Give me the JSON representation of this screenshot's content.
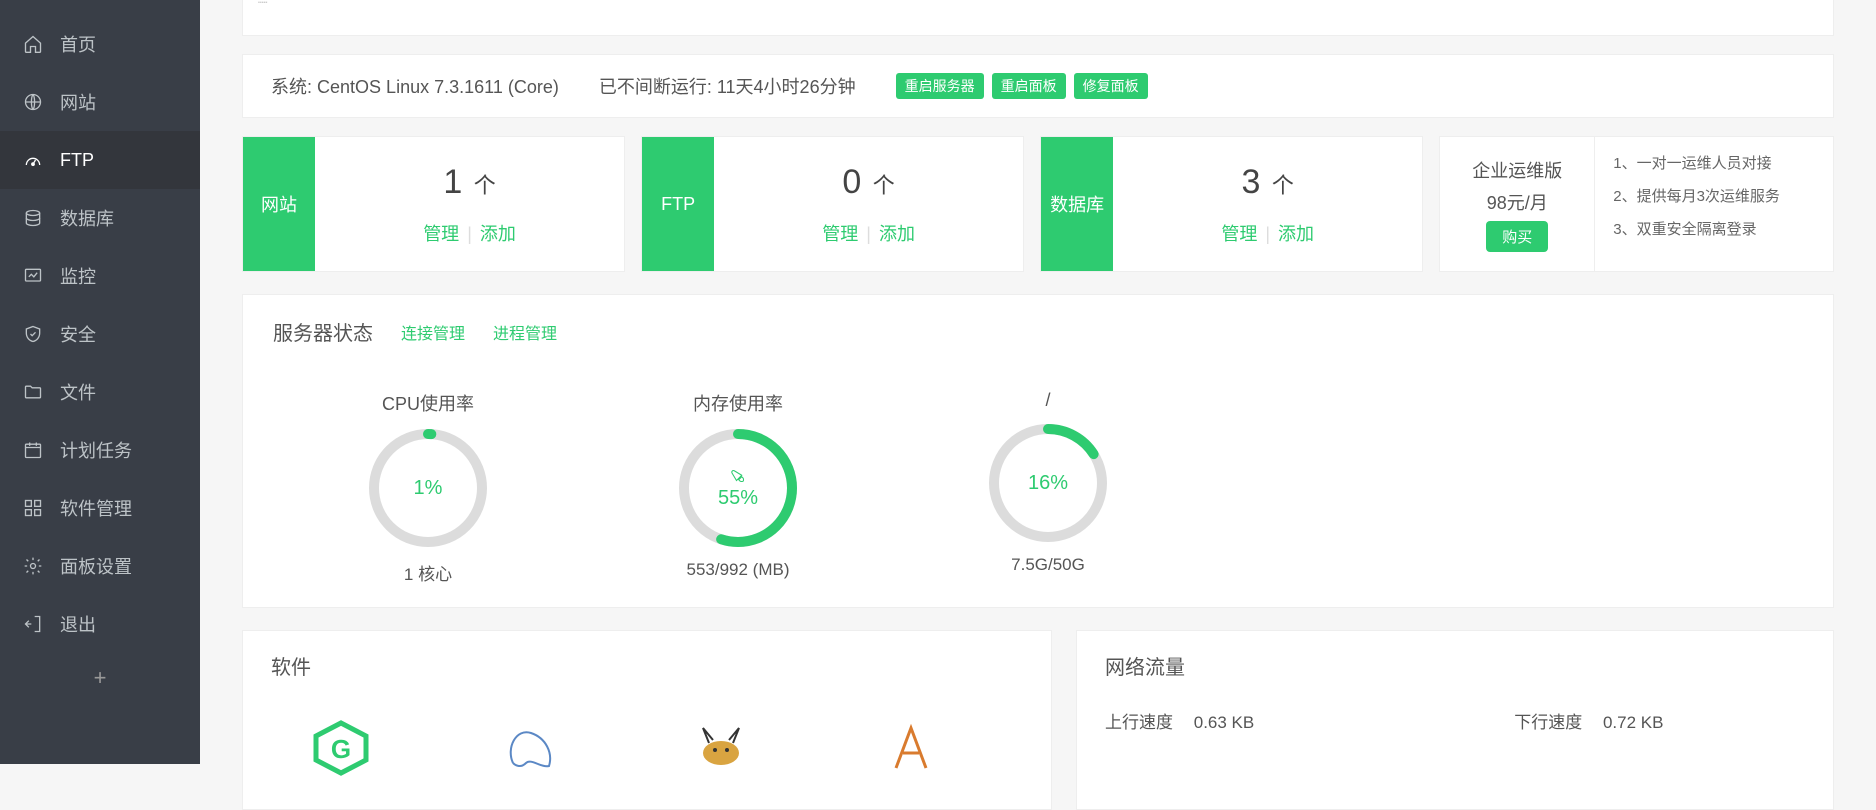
{
  "sidebar": {
    "items": [
      {
        "label": "首页",
        "icon": "home"
      },
      {
        "label": "网站",
        "icon": "globe"
      },
      {
        "label": "FTP",
        "icon": "dial"
      },
      {
        "label": "数据库",
        "icon": "database"
      },
      {
        "label": "监控",
        "icon": "monitor"
      },
      {
        "label": "安全",
        "icon": "shield"
      },
      {
        "label": "文件",
        "icon": "folder"
      },
      {
        "label": "计划任务",
        "icon": "calendar"
      },
      {
        "label": "软件管理",
        "icon": "apps"
      },
      {
        "label": "面板设置",
        "icon": "gear"
      },
      {
        "label": "退出",
        "icon": "exit"
      }
    ],
    "active_index": 2
  },
  "header": {
    "system_label": "系统:",
    "system_value": "CentOS Linux 7.3.1611 (Core)",
    "uptime_label": "已不间断运行:",
    "uptime_value": "11天4小时26分钟",
    "buttons": [
      "重启服务器",
      "重启面板",
      "修复面板"
    ]
  },
  "stats": [
    {
      "tag": "网站",
      "count": "1",
      "unit": "个",
      "manage": "管理",
      "add": "添加"
    },
    {
      "tag": "FTP",
      "count": "0",
      "unit": "个",
      "manage": "管理",
      "add": "添加"
    },
    {
      "tag": "数据库",
      "count": "3",
      "unit": "个",
      "manage": "管理",
      "add": "添加"
    }
  ],
  "promo": {
    "title": "企业运维版",
    "price": "98元/月",
    "buy": "购买",
    "features": [
      "1、一对一运维人员对接",
      "2、提供每月3次运维服务",
      "3、双重安全隔离登录"
    ]
  },
  "server_status": {
    "title": "服务器状态",
    "link_conn": "连接管理",
    "link_proc": "进程管理",
    "gauges": [
      {
        "title": "CPU使用率",
        "pct": 1,
        "pct_label": "1%",
        "sub": "1 核心"
      },
      {
        "title": "内存使用率",
        "pct": 55,
        "pct_label": "55%",
        "sub": "553/992 (MB)",
        "rocket": true
      },
      {
        "title": "/",
        "pct": 16,
        "pct_label": "16%",
        "sub": "7.5G/50G"
      }
    ]
  },
  "software": {
    "title": "软件",
    "apps": [
      "nginx",
      "mysql",
      "tomcat",
      "apache"
    ]
  },
  "traffic": {
    "title": "网络流量",
    "up_label": "上行速度",
    "up_value": "0.63 KB",
    "down_label": "下行速度",
    "down_value": "0.72 KB"
  }
}
